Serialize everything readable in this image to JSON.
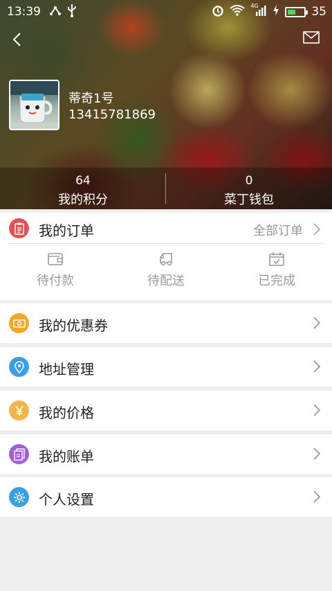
{
  "status_bar": {
    "time": "13:39",
    "battery_level": "35",
    "network": "4G",
    "left_icons": [
      "usb-share-icon",
      "usb-icon"
    ],
    "right_icons": [
      "alarm-icon",
      "wifi-icon",
      "signal-icon",
      "charging-icon",
      "battery-icon"
    ]
  },
  "header": {
    "back_icon": "chevron-left-icon",
    "mail_icon": "mail-icon"
  },
  "user": {
    "name": "蒂奇1号",
    "phone": "13415781869"
  },
  "stats": [
    {
      "value": "64",
      "label": "我的积分"
    },
    {
      "value": "0",
      "label": "菜丁钱包"
    }
  ],
  "orders": {
    "title": "我的订单",
    "all_label": "全部订单",
    "states": [
      {
        "label": "待付款",
        "icon": "wallet-icon"
      },
      {
        "label": "待配送",
        "icon": "truck-icon"
      },
      {
        "label": "已完成",
        "icon": "calendar-check-icon"
      }
    ]
  },
  "menu": [
    {
      "label": "我的优惠券",
      "icon": "coupon-icon",
      "color": "#f5a623"
    },
    {
      "label": "地址管理",
      "icon": "location-icon",
      "color": "#3a9fe8"
    },
    {
      "label": "我的价格",
      "icon": "yen-icon",
      "color": "#f3b54a"
    },
    {
      "label": "我的账单",
      "icon": "bill-icon",
      "color": "#a25fd8"
    },
    {
      "label": "个人设置",
      "icon": "gear-icon",
      "color": "#3a9fe8"
    }
  ],
  "colors": {
    "order_icon": "#e85050",
    "divider_bg": "#eeeeee",
    "muted_text": "#999999"
  }
}
